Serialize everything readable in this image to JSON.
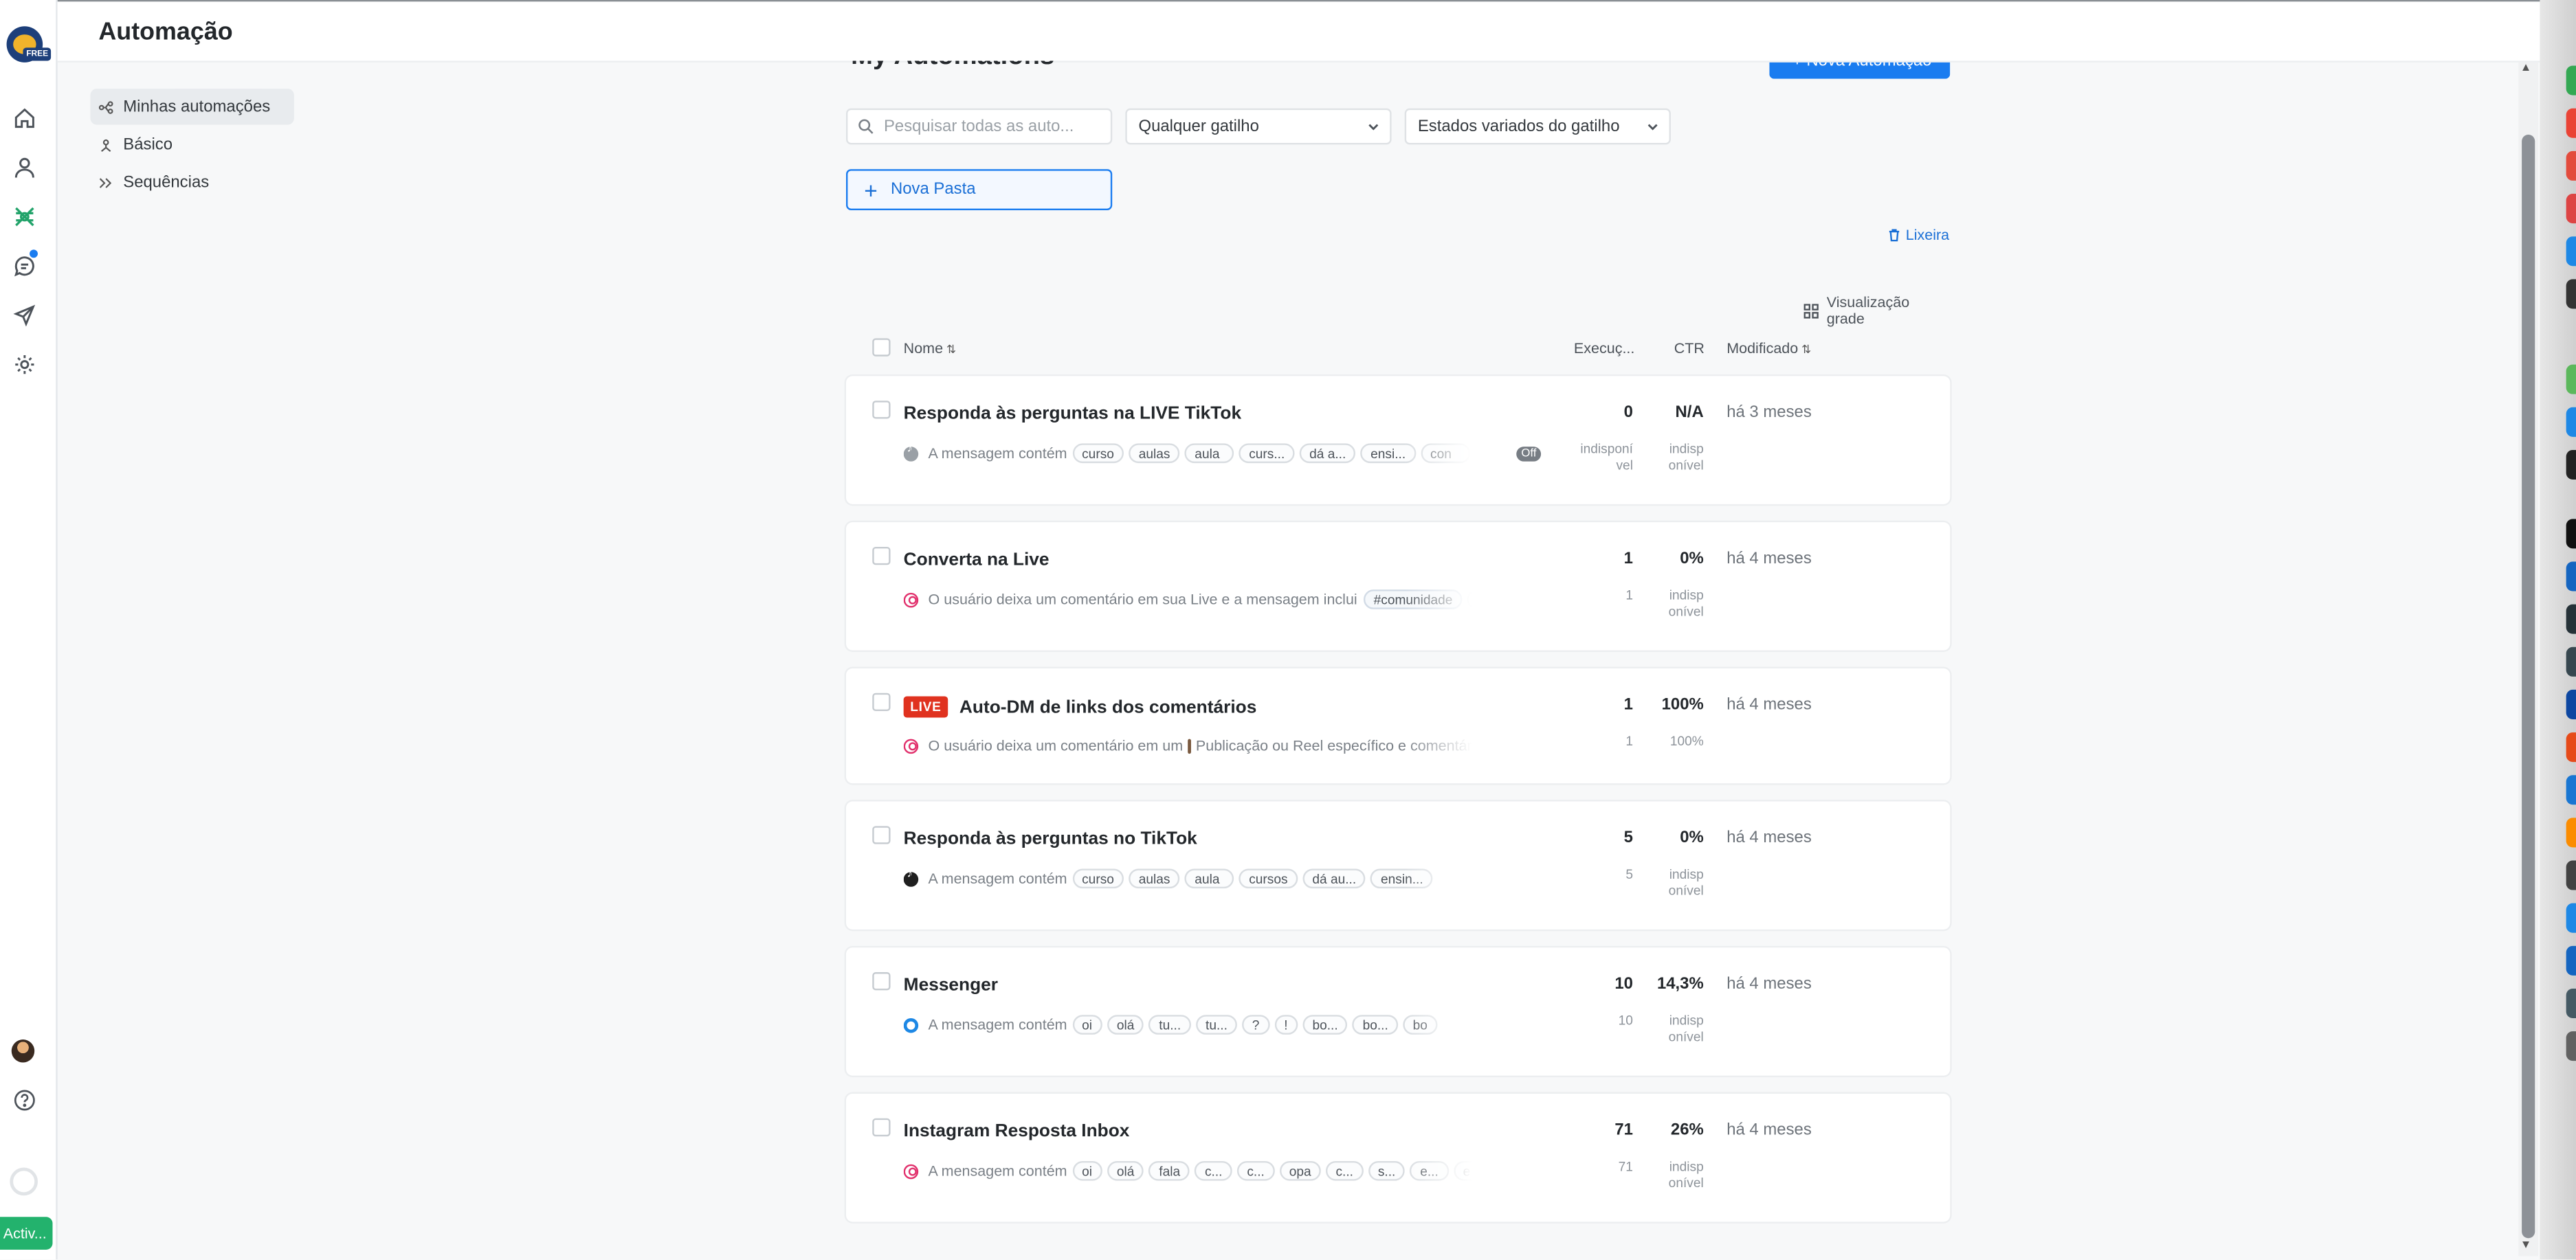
{
  "header": {
    "title": "Automação"
  },
  "rail": {
    "icons": [
      "home-icon",
      "contacts-icon",
      "automation-icon",
      "chat-icon",
      "broadcast-icon",
      "settings-icon"
    ],
    "plan_badge": "FREE",
    "activate_label": "Activ..."
  },
  "nav": {
    "items": [
      {
        "label": "Minhas automações",
        "active": true
      },
      {
        "label": "Básico",
        "active": false
      },
      {
        "label": "Sequências",
        "active": false
      }
    ]
  },
  "main": {
    "title": "My Automations",
    "new_automation_button": "+ Nova Automação",
    "search_placeholder": "Pesquisar todas as auto...",
    "trigger_filter": "Qualquer gatilho",
    "state_filter": "Estados variados do gatilho",
    "new_folder_button": "Nova Pasta",
    "trash_link": "Lixeira",
    "grid_view_label": "Visualização grade",
    "columns": {
      "name": "Nome",
      "executions": "Execuç...",
      "ctr": "CTR",
      "modified": "Modificado"
    }
  },
  "rows": [
    {
      "name": "Responda às perguntas na LIVE TikTok",
      "live": false,
      "trigger_text": "A mensagem contém",
      "tags": [
        "curso",
        "aulas",
        "aula",
        "curs...",
        "dá a...",
        "ensi...",
        "con"
      ],
      "status": "Off",
      "executions": "0",
      "ctr": "N/A",
      "modified": "há 3 meses",
      "sub_exec": "indisponí vel",
      "sub_ctr": "indisp onível"
    },
    {
      "name": "Converta na Live",
      "live": false,
      "trigger_text": "O usuário deixa um comentário em sua Live e a mensagem inclui",
      "tags": [
        "#comunidade",
        "#"
      ],
      "executions": "1",
      "ctr": "0%",
      "modified": "há 4 meses",
      "sub_exec": "1",
      "sub_ctr": "indisp onível"
    },
    {
      "name": "Auto-DM de links dos comentários",
      "live": true,
      "live_label": "LIVE",
      "trigger_text": "O usuário deixa um comentário em um",
      "trigger_text2": "Publicação ou Reel específico e comentár",
      "executions": "1",
      "ctr": "100%",
      "modified": "há 4 meses",
      "sub_exec": "1",
      "sub_ctr": "100%"
    },
    {
      "name": "Responda às perguntas no TikTok",
      "live": false,
      "trigger_text": "A mensagem contém",
      "tags": [
        "curso",
        "aulas",
        "aula",
        "cursos",
        "dá au...",
        "ensin..."
      ],
      "executions": "5",
      "ctr": "0%",
      "modified": "há 4 meses",
      "sub_exec": "5",
      "sub_ctr": "indisp onível"
    },
    {
      "name": "Messenger",
      "live": false,
      "trigger_text": "A mensagem contém",
      "tags": [
        "oi",
        "olá",
        "tu...",
        "tu...",
        "?",
        "!",
        "bo...",
        "bo...",
        "bo"
      ],
      "executions": "10",
      "ctr": "14,3%",
      "modified": "há 4 meses",
      "sub_exec": "10",
      "sub_ctr": "indisp onível"
    },
    {
      "name": "Instagram Resposta Inbox",
      "live": false,
      "trigger_text": "A mensagem contém",
      "tags": [
        "oi",
        "olá",
        "fala",
        "c...",
        "c...",
        "opa",
        "c...",
        "s...",
        "e...",
        "e..."
      ],
      "executions": "71",
      "ctr": "26%",
      "modified": "há 4 meses",
      "sub_exec": "71",
      "sub_ctr": "indisp onível"
    }
  ]
}
